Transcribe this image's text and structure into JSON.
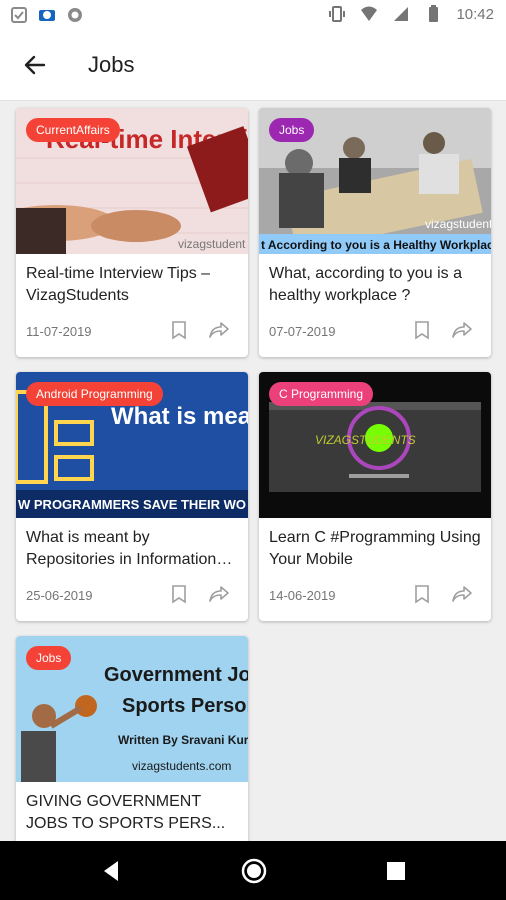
{
  "status_bar": {
    "time": "10:42"
  },
  "app_bar": {
    "title": "Jobs"
  },
  "cards": [
    {
      "category": "CurrentAffairs",
      "badge_color": "#f44336",
      "thumb_text": "Real-time Interview Tips",
      "title": "Real-time Interview Tips – VizagStudents",
      "date": "11-07-2019"
    },
    {
      "category": "Jobs",
      "badge_color": "#9c27b0",
      "thumb_text": "t According to you is a Healthy Workplace",
      "title": "What, according to you is a healthy workplace ?",
      "date": "07-07-2019"
    },
    {
      "category": "Android Programming",
      "badge_color": "#f44336",
      "thumb_text": "What is meant By Repository",
      "title": "What is meant by Repositories in Information Te...",
      "date": "25-06-2019"
    },
    {
      "category": "C Programming",
      "badge_color": "#ec407a",
      "thumb_text": "VIZAGSTUDENTS",
      "title": "Learn C #Programming Using Your Mobile",
      "date": "14-06-2019"
    },
    {
      "category": "Jobs",
      "badge_color": "#f44336",
      "thumb_text": "Government Jobs Sports Persons",
      "title": "GIVING GOVERNMENT JOBS TO SPORTS PERS...",
      "date": ""
    }
  ],
  "thumb_captions": {
    "c1_watermark": "vizagstudent",
    "c2_watermark": "vizagstudent",
    "c3_banner": "W PROGRAMMERS SAVE THEIR WO",
    "c5_line1": "Government Jobs",
    "c5_line2": "Sports Persons",
    "c5_byline": "Written By Sravani Kurre",
    "c5_site": "vizagstudents.com"
  },
  "colors": {
    "accent_red": "#f44336",
    "purple": "#9c27b0",
    "pink": "#ec407a"
  },
  "icons": [
    "back-arrow-icon",
    "bookmark-icon",
    "share-icon",
    "nav-back-icon",
    "nav-home-icon",
    "nav-recents-icon"
  ]
}
